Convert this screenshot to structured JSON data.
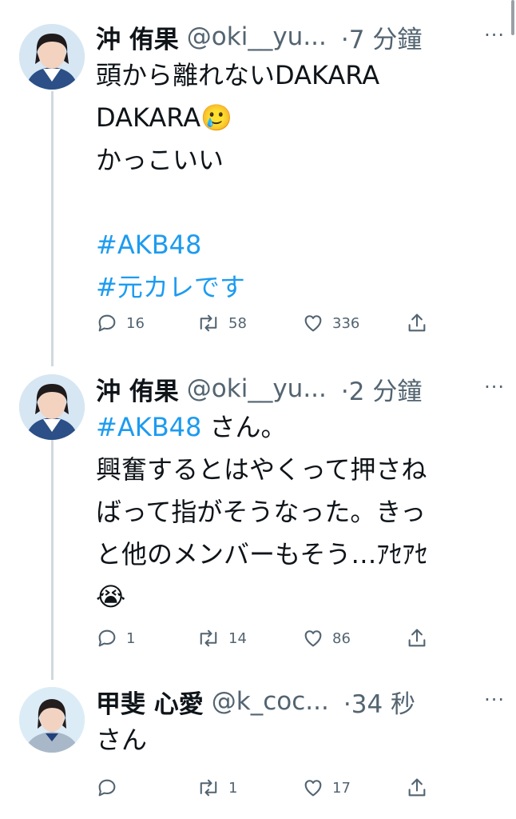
{
  "tweets": [
    {
      "name": "沖 侑果",
      "handle": "@oki__yu...",
      "time": "·7 分鐘",
      "more": "···",
      "text_plain": "頭から離れないDAKARA\nDAKARA🥲\nかっこいい\n\n",
      "hashtag_1": "#AKB48",
      "hashtag_2": "#元カレです",
      "replies": "16",
      "retweets": "58",
      "likes": "336"
    },
    {
      "name": "沖 侑果",
      "handle": "@oki__yu...",
      "time": "·2 分鐘",
      "more": "···",
      "hashtag_1": "#AKB48",
      "text_rest": " さん。\n興奮するとはやくって押さね\nばって指がそうなった。きっ\nと他のメンバーもそう…ｱｾｱｾ\n😭",
      "replies": "1",
      "retweets": "14",
      "likes": "86"
    },
    {
      "name": "甲斐 心愛",
      "handle": "@k_coc...",
      "time": "·34 秒",
      "more": "···",
      "text_plain": "さん",
      "replies": "",
      "retweets": "1",
      "likes": "17"
    }
  ],
  "icons": {
    "reply": "reply-icon",
    "retweet": "retweet-icon",
    "like": "heart-icon",
    "share": "share-icon",
    "more": "more-icon"
  },
  "colors": {
    "hashtag": "#1d9bf0",
    "secondary": "#536471",
    "thread": "#cfd9de"
  }
}
